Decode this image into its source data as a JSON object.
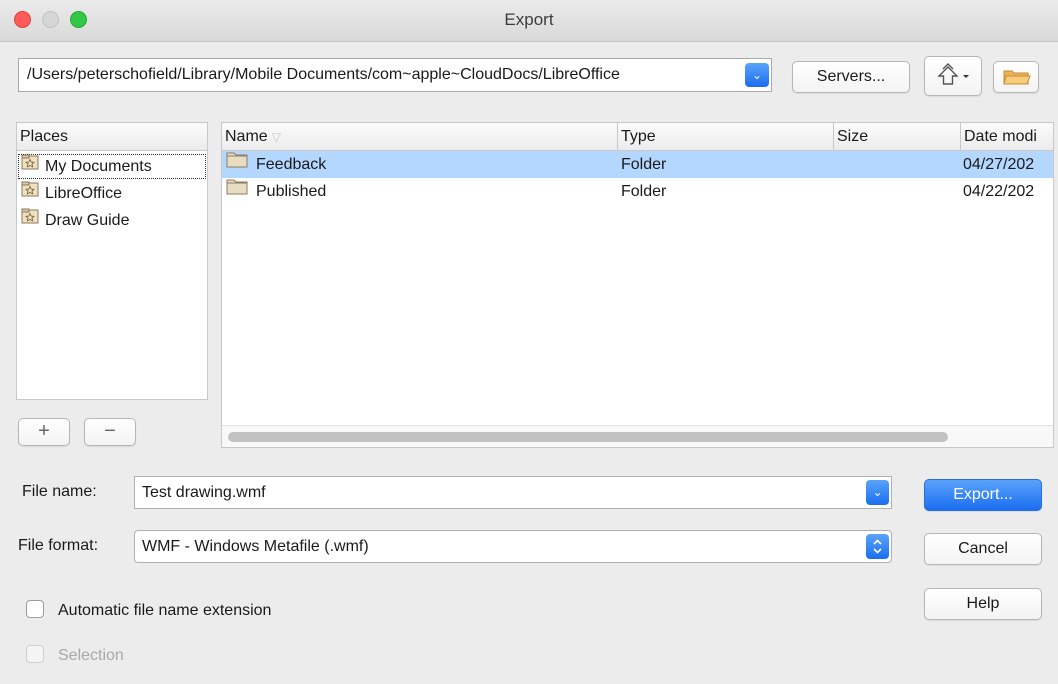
{
  "window": {
    "title": "Export"
  },
  "path": {
    "value": "/Users/peterschofield/Library/Mobile Documents/com~apple~CloudDocs/LibreOffice"
  },
  "toolbar": {
    "servers_label": "Servers...",
    "up_icon": "level-up-icon",
    "new_folder_icon": "new-folder-icon"
  },
  "places": {
    "header": "Places",
    "items": [
      {
        "label": "My Documents"
      },
      {
        "label": "LibreOffice"
      },
      {
        "label": "Draw Guide"
      }
    ],
    "add_label": "+",
    "remove_label": "−"
  },
  "filelist": {
    "columns": {
      "name": "Name",
      "type": "Type",
      "size": "Size",
      "date": "Date modi"
    },
    "rows": [
      {
        "name": "Feedback",
        "type": "Folder",
        "size": "",
        "date": "04/27/202",
        "selected": true
      },
      {
        "name": "Published",
        "type": "Folder",
        "size": "",
        "date": "04/22/202",
        "selected": false
      }
    ]
  },
  "form": {
    "filename_label": "File name:",
    "filename_value": "Test drawing.wmf",
    "format_label": "File format:",
    "format_value": "WMF - Windows Metafile (.wmf)",
    "auto_ext_label": "Automatic file name extension",
    "selection_label": "Selection"
  },
  "buttons": {
    "export": "Export...",
    "cancel": "Cancel",
    "help": "Help"
  },
  "colors": {
    "accent": "#1a6ef0",
    "selection": "#b3d7ff",
    "close": "#fc5b57",
    "maximize": "#33c748"
  }
}
